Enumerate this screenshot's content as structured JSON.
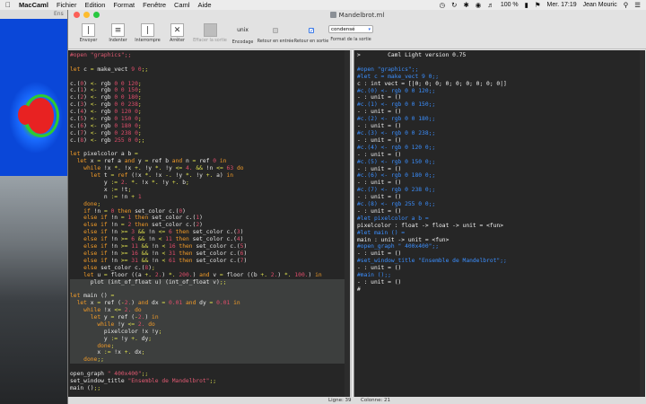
{
  "menubar": {
    "app": "MacCaml",
    "menus": [
      "Fichier",
      "Edition",
      "Format",
      "Fenêtre",
      "Caml",
      "Aide"
    ],
    "battery": "100 %",
    "datetime": "Mer. 17:19",
    "user": "Jean Mouric"
  },
  "window": {
    "title": "Mandelbrot.ml",
    "background_window_title": "Ens"
  },
  "toolbar": {
    "send": "Envoyer",
    "indent": "Indenter",
    "interrupt": "Interrompre",
    "stop": "Arrêter",
    "clear_output": "Effacer la sortie",
    "encoding_value": "unix",
    "encoding": "Encodage",
    "return_input": "Retour en entrée",
    "return_output": "Retour en sortie",
    "output_format_value": "condensé",
    "output_format": "Format de la sortie"
  },
  "status": {
    "line": "Ligne: 39",
    "column": "Colonne: 21"
  },
  "colors": {
    "keyword": "#f29b28",
    "operator": "#dfe04e",
    "number": "#e04d6b",
    "input_echo": "#3b8fff",
    "editor_bg": "#262626"
  }
}
